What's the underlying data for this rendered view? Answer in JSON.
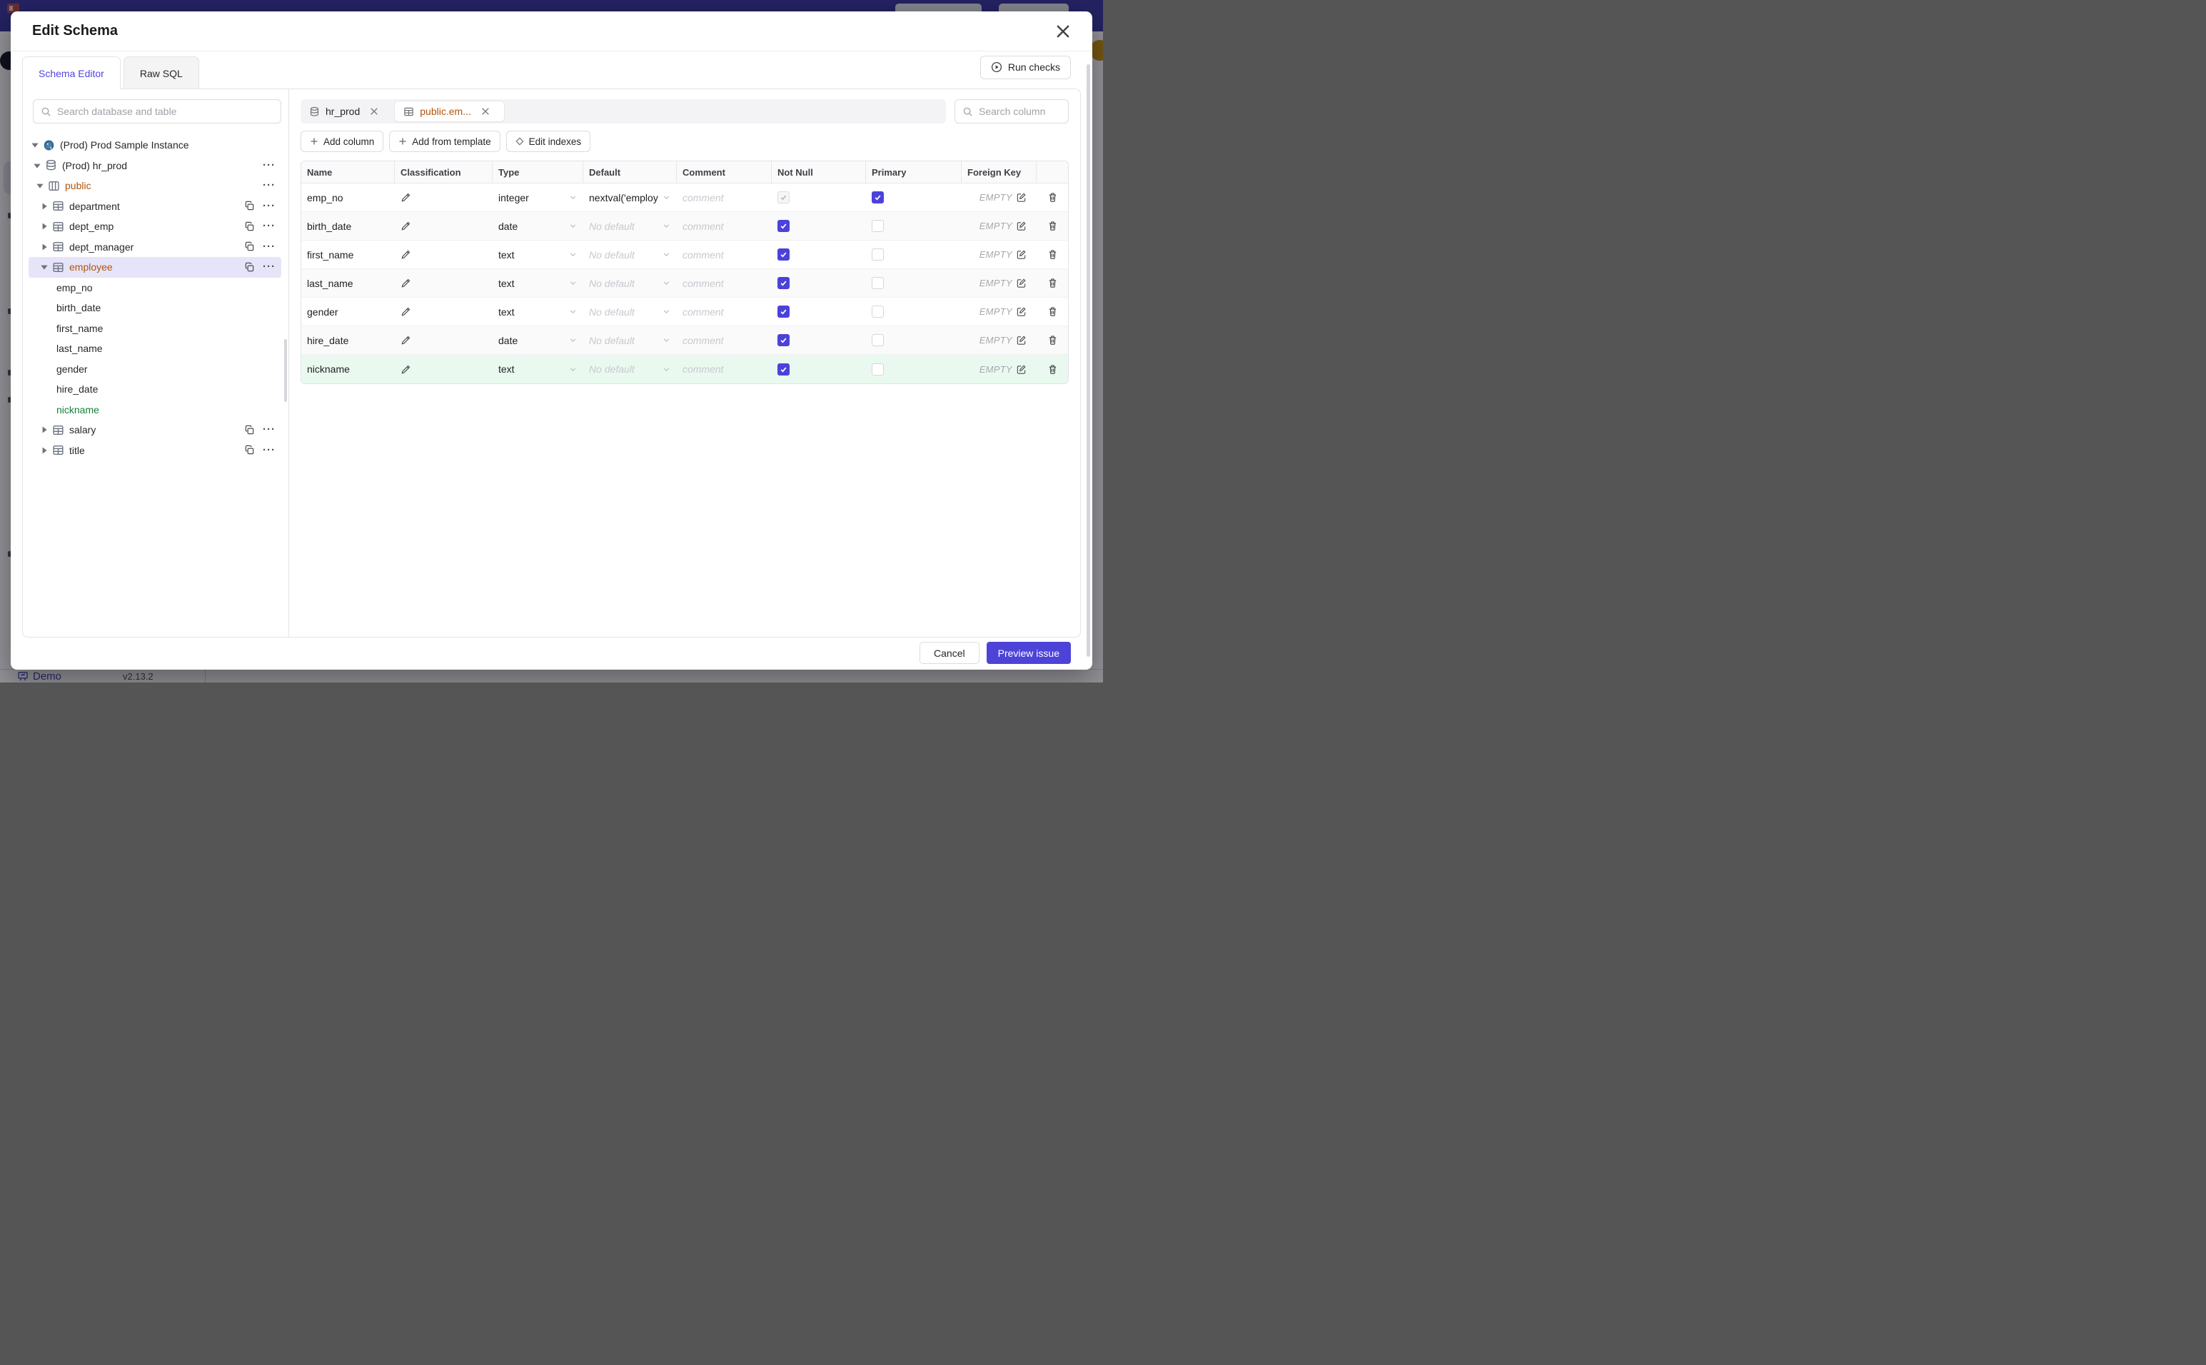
{
  "background": {
    "demo_label": "Demo",
    "version": "v2.13.2"
  },
  "modal": {
    "title": "Edit Schema"
  },
  "tabs": [
    {
      "label": "Schema Editor",
      "active": true
    },
    {
      "label": "Raw SQL",
      "active": false
    }
  ],
  "run_checks_label": "Run checks",
  "sidebar": {
    "search_placeholder": "Search database and table",
    "tree": [
      {
        "label": "(Prod) Prod Sample Instance",
        "kind": "instance",
        "icon": "postgres-icon",
        "level": 0,
        "caret": "down",
        "color": null,
        "selected": false,
        "actions": []
      },
      {
        "label": "(Prod) hr_prod",
        "kind": "database",
        "icon": "database-icon",
        "level": 1,
        "caret": "down",
        "color": null,
        "selected": false,
        "actions": [
          "more"
        ]
      },
      {
        "label": "public",
        "kind": "schema",
        "icon": "schema-icon",
        "level": 2,
        "caret": "down",
        "color": "amber",
        "selected": false,
        "actions": [
          "more"
        ]
      },
      {
        "label": "department",
        "kind": "table",
        "icon": "table-icon",
        "level": 3,
        "caret": "right",
        "color": null,
        "selected": false,
        "actions": [
          "copy",
          "more"
        ]
      },
      {
        "label": "dept_emp",
        "kind": "table",
        "icon": "table-icon",
        "level": 3,
        "caret": "right",
        "color": null,
        "selected": false,
        "actions": [
          "copy",
          "more"
        ]
      },
      {
        "label": "dept_manager",
        "kind": "table",
        "icon": "table-icon",
        "level": 3,
        "caret": "right",
        "color": null,
        "selected": false,
        "actions": [
          "copy",
          "more"
        ]
      },
      {
        "label": "employee",
        "kind": "table",
        "icon": "table-icon",
        "level": 3,
        "caret": "down",
        "color": "amber",
        "selected": true,
        "actions": [
          "copy",
          "more"
        ]
      },
      {
        "label": "emp_no",
        "kind": "column",
        "icon": null,
        "level": 4,
        "caret": null,
        "color": null,
        "selected": false,
        "actions": []
      },
      {
        "label": "birth_date",
        "kind": "column",
        "icon": null,
        "level": 4,
        "caret": null,
        "color": null,
        "selected": false,
        "actions": []
      },
      {
        "label": "first_name",
        "kind": "column",
        "icon": null,
        "level": 4,
        "caret": null,
        "color": null,
        "selected": false,
        "actions": []
      },
      {
        "label": "last_name",
        "kind": "column",
        "icon": null,
        "level": 4,
        "caret": null,
        "color": null,
        "selected": false,
        "actions": []
      },
      {
        "label": "gender",
        "kind": "column",
        "icon": null,
        "level": 4,
        "caret": null,
        "color": null,
        "selected": false,
        "actions": []
      },
      {
        "label": "hire_date",
        "kind": "column",
        "icon": null,
        "level": 4,
        "caret": null,
        "color": null,
        "selected": false,
        "actions": []
      },
      {
        "label": "nickname",
        "kind": "column",
        "icon": null,
        "level": 4,
        "caret": null,
        "color": "green",
        "selected": false,
        "actions": []
      },
      {
        "label": "salary",
        "kind": "table",
        "icon": "table-icon",
        "level": 3,
        "caret": "right",
        "color": null,
        "selected": false,
        "actions": [
          "copy",
          "more"
        ]
      },
      {
        "label": "title",
        "kind": "table",
        "icon": "table-icon",
        "level": 3,
        "caret": "right",
        "color": null,
        "selected": false,
        "actions": [
          "copy",
          "more"
        ]
      }
    ]
  },
  "editor": {
    "chips": [
      {
        "label": "hr_prod",
        "icon": "database-icon",
        "active": false
      },
      {
        "label": "public.em...",
        "icon": "table-icon",
        "active": true
      }
    ],
    "column_search_placeholder": "Search column",
    "action_buttons": [
      {
        "label": "Add column",
        "icon": "plus-icon"
      },
      {
        "label": "Add from template",
        "icon": "plus-icon"
      },
      {
        "label": "Edit indexes",
        "icon": "diamond-icon"
      }
    ],
    "table": {
      "headers": [
        "Name",
        "Classification",
        "Type",
        "Default",
        "Comment",
        "Not Null",
        "Primary",
        "Foreign Key",
        ""
      ],
      "comment_placeholder": "comment",
      "foreign_key_value": "EMPTY",
      "rows": [
        {
          "name": "emp_no",
          "type": "integer",
          "default": "nextval('employ",
          "default_placeholder": false,
          "not_null": true,
          "not_null_disabled": true,
          "primary": true,
          "new": false
        },
        {
          "name": "birth_date",
          "type": "date",
          "default": "No default",
          "default_placeholder": true,
          "not_null": true,
          "not_null_disabled": false,
          "primary": false,
          "new": false
        },
        {
          "name": "first_name",
          "type": "text",
          "default": "No default",
          "default_placeholder": true,
          "not_null": true,
          "not_null_disabled": false,
          "primary": false,
          "new": false
        },
        {
          "name": "last_name",
          "type": "text",
          "default": "No default",
          "default_placeholder": true,
          "not_null": true,
          "not_null_disabled": false,
          "primary": false,
          "new": false
        },
        {
          "name": "gender",
          "type": "text",
          "default": "No default",
          "default_placeholder": true,
          "not_null": true,
          "not_null_disabled": false,
          "primary": false,
          "new": false
        },
        {
          "name": "hire_date",
          "type": "date",
          "default": "No default",
          "default_placeholder": true,
          "not_null": true,
          "not_null_disabled": false,
          "primary": false,
          "new": false
        },
        {
          "name": "nickname",
          "type": "text",
          "default": "No default",
          "default_placeholder": true,
          "not_null": true,
          "not_null_disabled": false,
          "primary": false,
          "new": true
        }
      ]
    }
  },
  "footer": {
    "cancel_label": "Cancel",
    "submit_label": "Preview issue"
  },
  "colors": {
    "accent": "#4b42da",
    "amber": "#b45309",
    "green": "#15803d",
    "new_row_bg": "#e9f9ef",
    "selected_tree_bg": "#e6e4f9",
    "topbar": "#38349f",
    "postgres_blue": "#336791"
  }
}
